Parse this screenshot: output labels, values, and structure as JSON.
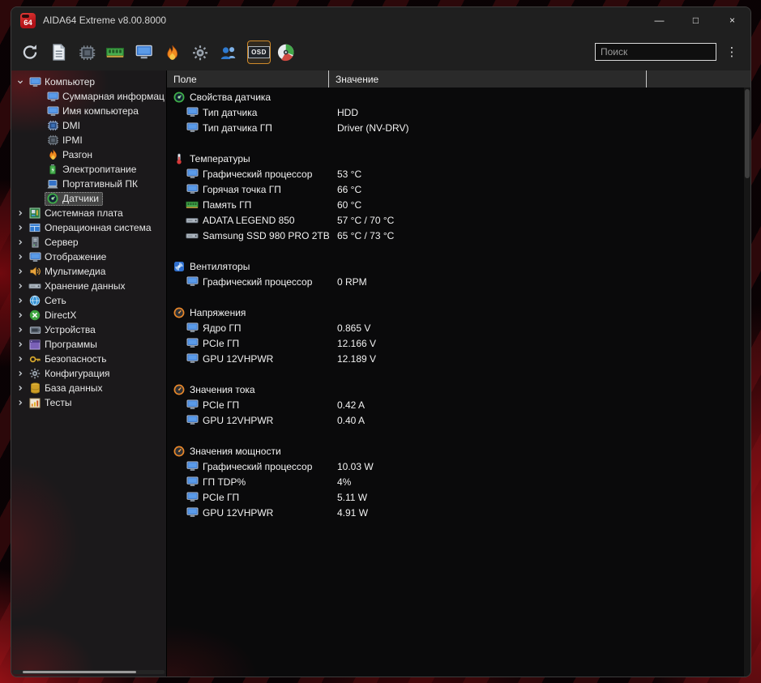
{
  "window": {
    "title": "AIDA64 Extreme v8.00.8000",
    "app_icon_text": "64",
    "controls": {
      "minimize": "—",
      "maximize": "□",
      "close": "×"
    }
  },
  "toolbar": {
    "search_placeholder": "Поиск",
    "menu_glyph": "⋮",
    "buttons": [
      {
        "id": "refresh",
        "icon": "refresh"
      },
      {
        "id": "report",
        "icon": "report"
      },
      {
        "id": "cpuid",
        "icon": "chip"
      },
      {
        "id": "memory-benchmark",
        "icon": "memory"
      },
      {
        "id": "gpu-info",
        "icon": "monitor"
      },
      {
        "id": "stability-test",
        "icon": "flame"
      },
      {
        "id": "settings",
        "icon": "gear"
      },
      {
        "id": "community",
        "icon": "people"
      },
      {
        "id": "osd",
        "label": "OSD",
        "active": true
      },
      {
        "id": "sensor-panel",
        "icon": "disc"
      }
    ]
  },
  "sidebar": {
    "items": [
      {
        "id": "computer",
        "label": "Компьютер",
        "icon": "monitor",
        "level": 0,
        "expanded": true
      },
      {
        "id": "summary",
        "label": "Суммарная информац",
        "icon": "monitor",
        "level": 1
      },
      {
        "id": "computer-name",
        "label": "Имя компьютера",
        "icon": "monitor",
        "level": 1
      },
      {
        "id": "dmi",
        "label": "DMI",
        "icon": "chipblue",
        "level": 1
      },
      {
        "id": "ipmi",
        "label": "IPMI",
        "icon": "chip",
        "level": 1
      },
      {
        "id": "overclock",
        "label": "Разгон",
        "icon": "flame",
        "level": 1
      },
      {
        "id": "power",
        "label": "Электропитание",
        "icon": "battery",
        "level": 1
      },
      {
        "id": "portable-pc",
        "label": "Портативный ПК",
        "icon": "laptop",
        "level": 1
      },
      {
        "id": "sensors",
        "label": "Датчики",
        "icon": "sensor",
        "level": 1,
        "selected": true
      },
      {
        "id": "motherboard",
        "label": "Системная плата",
        "icon": "motherboard",
        "level": 0
      },
      {
        "id": "operating-system",
        "label": "Операционная система",
        "icon": "os",
        "level": 0
      },
      {
        "id": "server",
        "label": "Сервер",
        "icon": "server",
        "level": 0
      },
      {
        "id": "display",
        "label": "Отображение",
        "icon": "monitor",
        "level": 0
      },
      {
        "id": "multimedia",
        "label": "Мультимедиа",
        "icon": "multimedia",
        "level": 0
      },
      {
        "id": "storage",
        "label": "Хранение данных",
        "icon": "drive",
        "level": 0
      },
      {
        "id": "network",
        "label": "Сеть",
        "icon": "network",
        "level": 0
      },
      {
        "id": "directx",
        "label": "DirectX",
        "icon": "directx",
        "level": 0
      },
      {
        "id": "devices",
        "label": "Устройства",
        "icon": "devices",
        "level": 0
      },
      {
        "id": "programs",
        "label": "Программы",
        "icon": "programs",
        "level": 0
      },
      {
        "id": "security",
        "label": "Безопасность",
        "icon": "security",
        "level": 0
      },
      {
        "id": "config",
        "label": "Конфигурация",
        "icon": "gear",
        "level": 0
      },
      {
        "id": "database",
        "label": "База данных",
        "icon": "database",
        "level": 0
      },
      {
        "id": "benchmarks",
        "label": "Тесты",
        "icon": "tests",
        "level": 0
      }
    ]
  },
  "main": {
    "columns": [
      "Поле",
      "Значение"
    ],
    "groups": [
      {
        "id": "sensor-properties",
        "label": "Свойства датчика",
        "icon": "sensor",
        "rows": [
          {
            "field": "Тип датчика",
            "value": "HDD",
            "icon": "monitor"
          },
          {
            "field": "Тип датчика ГП",
            "value": "Driver (NV-DRV)",
            "icon": "monitor"
          }
        ]
      },
      {
        "id": "temperatures",
        "label": "Температуры",
        "icon": "thermo",
        "rows": [
          {
            "field": "Графический процессор",
            "value": "53 °C",
            "icon": "monitor"
          },
          {
            "field": "Горячая точка ГП",
            "value": "66 °C",
            "icon": "monitor"
          },
          {
            "field": "Память ГП",
            "value": "60 °C",
            "icon": "memory"
          },
          {
            "field": "ADATA LEGEND 850",
            "value": "57 °C / 70 °C",
            "icon": "drive"
          },
          {
            "field": "Samsung SSD 980 PRO 2TB",
            "value": "65 °C / 73 °C",
            "icon": "drive"
          }
        ]
      },
      {
        "id": "fans",
        "label": "Вентиляторы",
        "icon": "fan",
        "rows": [
          {
            "field": "Графический процессор",
            "value": "0 RPM",
            "icon": "monitor"
          }
        ]
      },
      {
        "id": "voltages",
        "label": "Напряжения",
        "icon": "gauge",
        "rows": [
          {
            "field": "Ядро ГП",
            "value": "0.865 V",
            "icon": "monitor"
          },
          {
            "field": "PCIe ГП",
            "value": "12.166 V",
            "icon": "monitor"
          },
          {
            "field": "GPU 12VHPWR",
            "value": "12.189 V",
            "icon": "monitor"
          }
        ]
      },
      {
        "id": "currents",
        "label": "Значения тока",
        "icon": "gauge",
        "rows": [
          {
            "field": "PCIe ГП",
            "value": "0.42 A",
            "icon": "monitor"
          },
          {
            "field": "GPU 12VHPWR",
            "value": "0.40 A",
            "icon": "monitor"
          }
        ]
      },
      {
        "id": "powers",
        "label": "Значения мощности",
        "icon": "gauge",
        "rows": [
          {
            "field": "Графический процессор",
            "value": "10.03 W",
            "icon": "monitor"
          },
          {
            "field": "ГП TDP%",
            "value": "4%",
            "icon": "monitor"
          },
          {
            "field": "PCIe ГП",
            "value": "5.11 W",
            "icon": "monitor"
          },
          {
            "field": "GPU 12VHPWR",
            "value": "4.91 W",
            "icon": "monitor"
          }
        ]
      }
    ]
  }
}
